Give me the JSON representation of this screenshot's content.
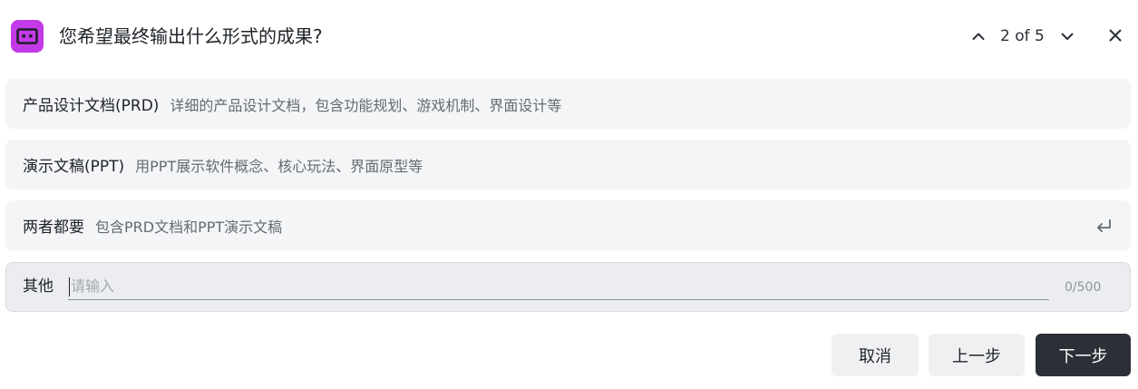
{
  "header": {
    "app_icon": "robot-face-icon",
    "question": "您希望最终输出什么形式的成果?",
    "pager_text": "2 of 5",
    "prev_icon": "chevron-up-icon",
    "next_icon": "chevron-down-icon",
    "close_icon": "close-icon"
  },
  "options": [
    {
      "title": "产品设计文档(PRD)",
      "description": "详细的产品设计文档，包含功能规划、游戏机制、界面设计等"
    },
    {
      "title": "演示文稿(PPT)",
      "description": "用PPT展示软件概念、核心玩法、界面原型等"
    },
    {
      "title": "两者都要",
      "description": "包含PRD文档和PPT演示文稿",
      "icon": "enter-return-icon"
    }
  ],
  "other": {
    "label": "其他",
    "placeholder": "请输入",
    "value": "",
    "counter": "0/500"
  },
  "footer": {
    "cancel_label": "取消",
    "prev_label": "上一步",
    "next_label": "下一步"
  },
  "colors": {
    "accent": "#c33ae8",
    "primary_button": "#2b2f36",
    "option_bg": "#f4f5f7"
  }
}
